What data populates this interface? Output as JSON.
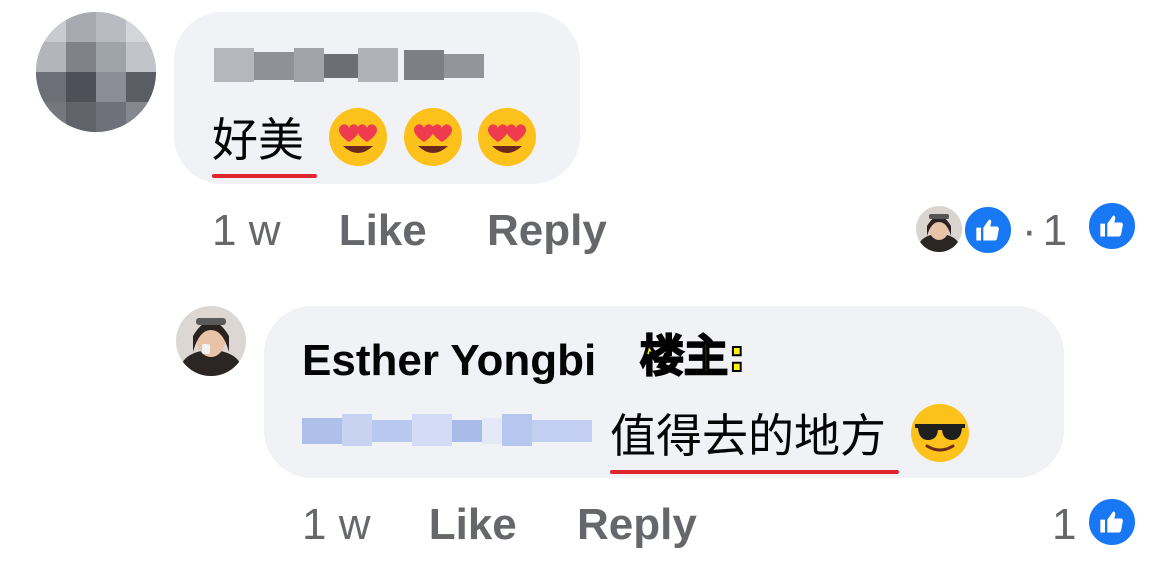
{
  "comment1": {
    "text": "好美",
    "emojis": [
      "heart-eyes-emoji",
      "heart-eyes-emoji",
      "heart-eyes-emoji"
    ],
    "time": "1 w",
    "like_label": "Like",
    "reply_label": "Reply",
    "reactions_count": "1",
    "dot": "·"
  },
  "reply1": {
    "author": "Esther Yongbi",
    "author_tag": "楼主:",
    "text": "值得去的地方",
    "emoji": "sunglasses-emoji",
    "time": "1 w",
    "like_label": "Like",
    "reply_label": "Reply",
    "reactions_count": "1"
  },
  "colors": {
    "bubble": "#f0f2f5",
    "meta_text": "#65676b",
    "like_blue": "#1877f2",
    "underline_red": "#e0252c",
    "tag_yellow": "#fff200"
  }
}
